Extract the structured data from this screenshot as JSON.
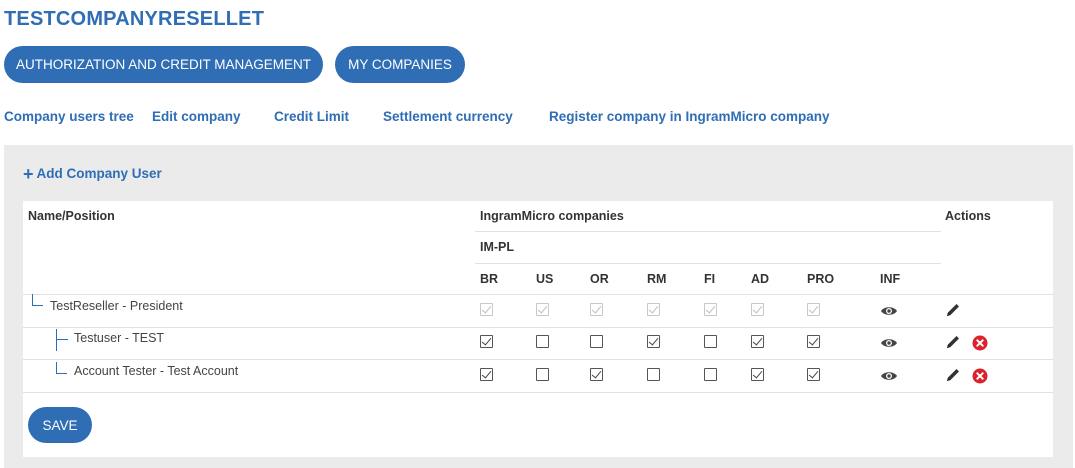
{
  "page": {
    "title": "TESTCOMPANYRESELLET"
  },
  "pills": [
    {
      "label": "AUTHORIZATION AND CREDIT MANAGEMENT"
    },
    {
      "label": "MY COMPANIES"
    }
  ],
  "links": [
    {
      "label": "Company users tree"
    },
    {
      "label": "Edit company"
    },
    {
      "label": "Credit Limit"
    },
    {
      "label": "Settlement currency"
    },
    {
      "label": "Register company in IngramMicro company"
    }
  ],
  "panel": {
    "add_user_label": "Add Company User",
    "save_label": "SAVE"
  },
  "table": {
    "col_name": "Name/Position",
    "col_group": "IngramMicro companies",
    "col_company": "IM-PL",
    "col_actions": "Actions",
    "sub_columns": [
      "BR",
      "US",
      "OR",
      "RM",
      "FI",
      "AD",
      "PRO",
      "INF"
    ],
    "rows": [
      {
        "name": "TestReseller - President",
        "level": 0,
        "disabled": true,
        "checks": [
          true,
          true,
          true,
          true,
          true,
          true,
          true
        ],
        "deletable": false
      },
      {
        "name": "Testuser - TEST",
        "level": 1,
        "disabled": false,
        "checks": [
          true,
          false,
          false,
          true,
          false,
          true,
          true
        ],
        "deletable": true
      },
      {
        "name": "Account Tester - Test Account",
        "level": 1,
        "disabled": false,
        "checks": [
          true,
          false,
          true,
          false,
          false,
          true,
          true
        ],
        "deletable": true
      }
    ]
  },
  "colors": {
    "accent": "#2f6db5",
    "panel_bg": "#ebebeb",
    "delete": "#d9232e"
  },
  "icons": {
    "info": "eye-icon",
    "edit": "pencil-icon",
    "delete": "delete-icon",
    "add": "plus-icon"
  }
}
